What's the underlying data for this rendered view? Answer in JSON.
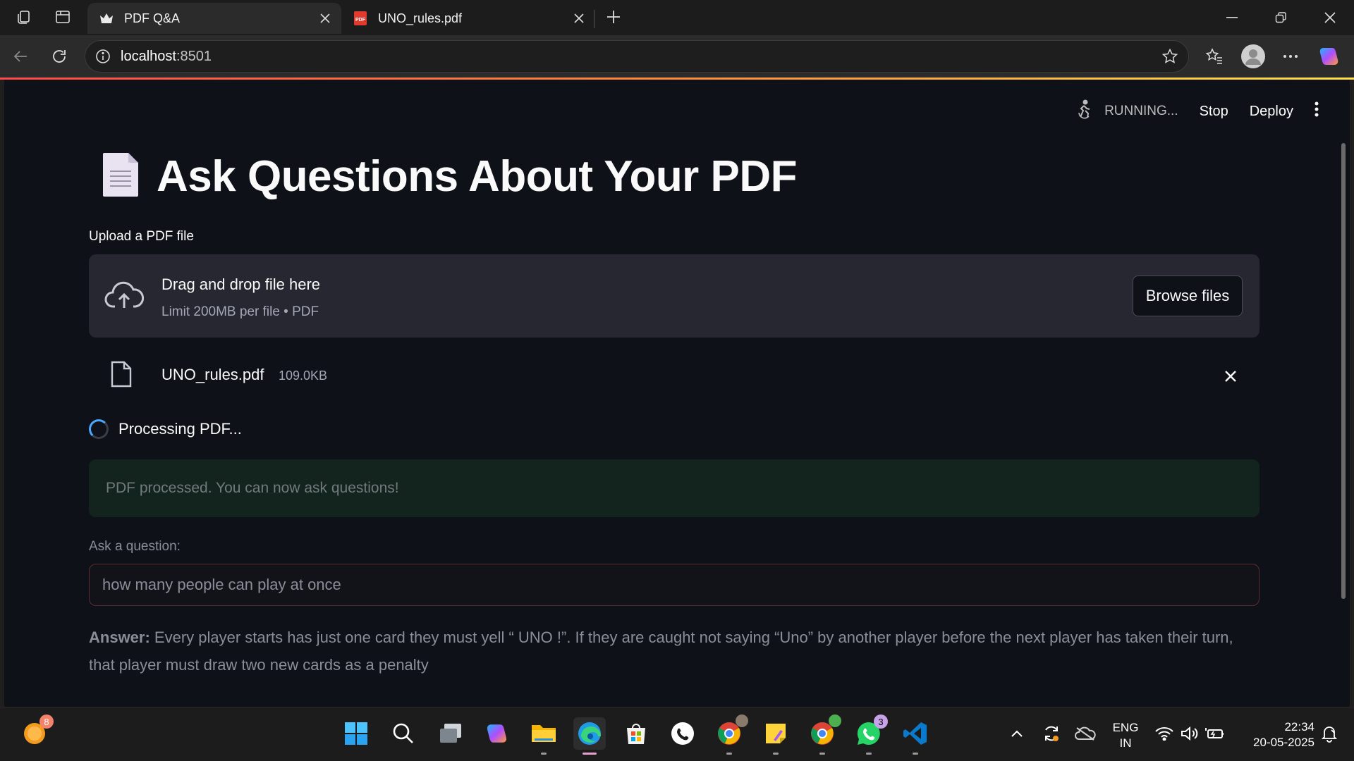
{
  "browser": {
    "tabs": [
      {
        "label": "PDF Q&A",
        "active": true
      },
      {
        "label": "UNO_rules.pdf",
        "active": false
      }
    ],
    "address": {
      "host": "localhost",
      "port": ":8501"
    }
  },
  "app": {
    "toolbar": {
      "status": "RUNNING...",
      "stop": "Stop",
      "deploy": "Deploy"
    },
    "title": "Ask Questions About Your PDF",
    "upload": {
      "label": "Upload a PDF file",
      "drop_text": "Drag and drop file here",
      "limit_text": "Limit 200MB per file • PDF",
      "browse": "Browse files"
    },
    "file": {
      "name": "UNO_rules.pdf",
      "size": "109.0KB"
    },
    "processing": "Processing PDF...",
    "success": "PDF processed. You can now ask questions!",
    "question": {
      "label": "Ask a question:",
      "value": "how many people can play at once"
    },
    "answer": {
      "label": "Answer:",
      "text": " Every player starts has just one card they must yell “ UNO !”. If they are caught not saying “Uno” by another player before the next player has taken their turn, that player must draw two new cards as a penalty"
    }
  },
  "taskbar": {
    "badges": {
      "widget": "8",
      "whatsapp": "3"
    },
    "lang": {
      "line1": "ENG",
      "line2": "IN"
    },
    "clock": {
      "time": "22:34",
      "date": "20-05-2025"
    }
  },
  "colors": {
    "accent": "#ff4b4b",
    "app_bg": "#0e1117",
    "spinner": "#4aa8ff"
  }
}
